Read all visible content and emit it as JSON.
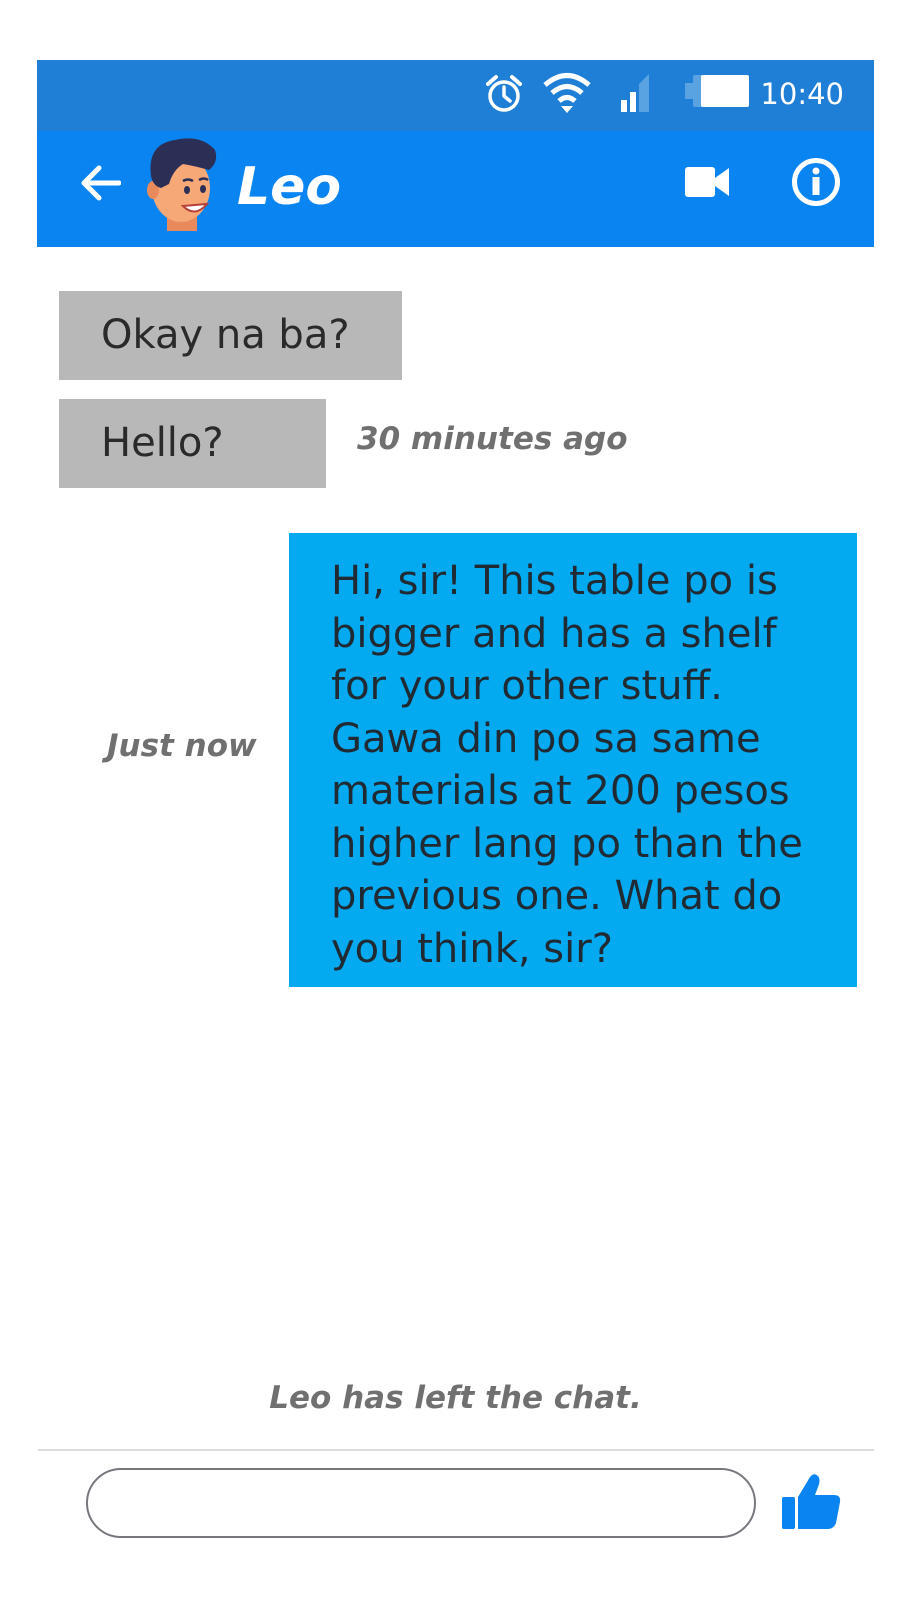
{
  "status_bar": {
    "time": "10:40",
    "icons": [
      "alarm-icon",
      "wifi-icon",
      "signal-icon",
      "battery-icon"
    ]
  },
  "header": {
    "contact_name": "Leo",
    "icons": [
      "back-arrow-icon",
      "avatar",
      "video-call-icon",
      "info-icon"
    ]
  },
  "messages": {
    "received_1": "Okay na ba?",
    "received_2": "Hello?",
    "received_2_time": "30 minutes ago",
    "sent_1_lines": [
      "Hi, sir! This table po is",
      "bigger and has a shelf",
      "for your other stuff.",
      "Gawa din po sa same",
      "materials at 200 pesos",
      "higher lang po than the",
      "previous one. What do",
      "you think, sir?"
    ],
    "sent_1_time": "Just now"
  },
  "system_message": "Leo has left the chat.",
  "composer": {
    "input_value": "",
    "send_icon": "thumbs-up-icon"
  },
  "colors": {
    "status_bar": "#1f7fd6",
    "header": "#0a84f0",
    "received_bubble": "#b8b8b8",
    "sent_bubble": "#04aaf0",
    "like_icon": "#0a84f0"
  }
}
